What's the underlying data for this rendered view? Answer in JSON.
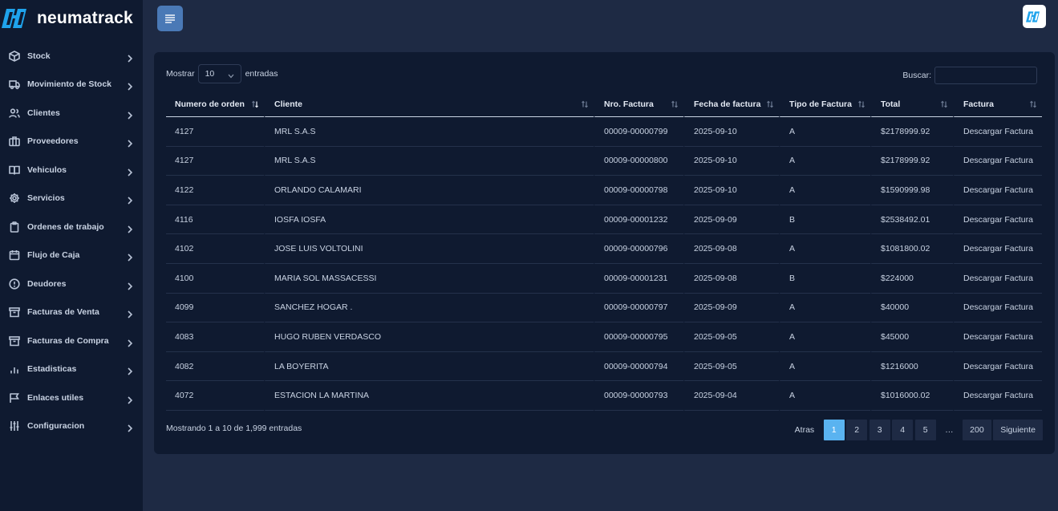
{
  "brand": {
    "name": "neumatrack",
    "accent": "#1fa3ec"
  },
  "sidebar": {
    "items": [
      {
        "label": "Stock",
        "icon": "box-icon"
      },
      {
        "label": "Movimiento de Stock",
        "icon": "truck-icon"
      },
      {
        "label": "Clientes",
        "icon": "users-icon"
      },
      {
        "label": "Proveedores",
        "icon": "briefcase-icon"
      },
      {
        "label": "Vehiculos",
        "icon": "book-icon"
      },
      {
        "label": "Servicios",
        "icon": "gear-icon"
      },
      {
        "label": "Ordenes de trabajo",
        "icon": "clipboard-icon"
      },
      {
        "label": "Flujo de Caja",
        "icon": "calendar-icon"
      },
      {
        "label": "Deudores",
        "icon": "alert-circle-icon"
      },
      {
        "label": "Facturas de Venta",
        "icon": "archive-icon"
      },
      {
        "label": "Facturas de Compra",
        "icon": "archive-icon"
      },
      {
        "label": "Estadisticas",
        "icon": "bar-chart-icon"
      },
      {
        "label": "Enlaces utiles",
        "icon": "flag-icon"
      },
      {
        "label": "Configuracion",
        "icon": "sliders-icon"
      }
    ]
  },
  "controls": {
    "show_label": "Mostrar",
    "page_size": "10",
    "entries_label": "entradas",
    "search_label": "Buscar:",
    "search_value": ""
  },
  "table": {
    "columns": [
      "Numero de orden",
      "Cliente",
      "Nro. Factura",
      "Fecha de factura",
      "Tipo de Factura",
      "Total",
      "Factura"
    ],
    "sorted_column": 0,
    "rows": [
      [
        "4127",
        "MRL S.A.S",
        "00009-00000799",
        "2025-09-10",
        "A",
        "$2178999.92",
        "Descargar Factura"
      ],
      [
        "4127",
        "MRL S.A.S",
        "00009-00000800",
        "2025-09-10",
        "A",
        "$2178999.92",
        "Descargar Factura"
      ],
      [
        "4122",
        "ORLANDO CALAMARI",
        "00009-00000798",
        "2025-09-10",
        "A",
        "$1590999.98",
        "Descargar Factura"
      ],
      [
        "4116",
        "IOSFA IOSFA",
        "00009-00001232",
        "2025-09-09",
        "B",
        "$2538492.01",
        "Descargar Factura"
      ],
      [
        "4102",
        "JOSE LUIS VOLTOLINI",
        "00009-00000796",
        "2025-09-08",
        "A",
        "$1081800.02",
        "Descargar Factura"
      ],
      [
        "4100",
        "MARIA SOL MASSACESSI",
        "00009-00001231",
        "2025-09-08",
        "B",
        "$224000",
        "Descargar Factura"
      ],
      [
        "4099",
        "SANCHEZ HOGAR .",
        "00009-00000797",
        "2025-09-09",
        "A",
        "$40000",
        "Descargar Factura"
      ],
      [
        "4083",
        "HUGO RUBEN VERDASCO",
        "00009-00000795",
        "2025-09-05",
        "A",
        "$45000",
        "Descargar Factura"
      ],
      [
        "4082",
        "LA BOYERITA",
        "00009-00000794",
        "2025-09-05",
        "A",
        "$1216000",
        "Descargar Factura"
      ],
      [
        "4072",
        "ESTACION LA MARTINA",
        "00009-00000793",
        "2025-09-04",
        "A",
        "$1016000.02",
        "Descargar Factura"
      ]
    ]
  },
  "footer": {
    "info": "Mostrando 1 a 10 de 1,999 entradas",
    "prev": "Atras",
    "pages": [
      "1",
      "2",
      "3",
      "4",
      "5"
    ],
    "active_page": "1",
    "ellipsis": "…",
    "last_page": "200",
    "next": "Siguiente"
  },
  "colors": {
    "background": "#1e2a44",
    "panel": "#0f1a30",
    "menu_button": "#4a79b6",
    "active_page": "#5ab3f0"
  }
}
